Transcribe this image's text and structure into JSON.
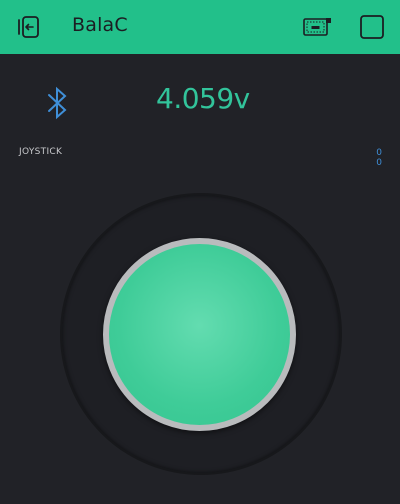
{
  "header": {
    "title": "BalaC",
    "back_icon": "back-arrow-icon",
    "device_icon": "device-icon",
    "stop_icon": "square-icon",
    "background_color": "#22c08a"
  },
  "bluetooth": {
    "icon": "bluetooth-icon",
    "color": "#3f8fd8"
  },
  "voltage": {
    "value": "4.059v",
    "color": "#32c49b"
  },
  "joystick": {
    "label": "JOYSTICK",
    "x_value": "0",
    "y_value": "0",
    "knob_color": "#3fcc98"
  }
}
